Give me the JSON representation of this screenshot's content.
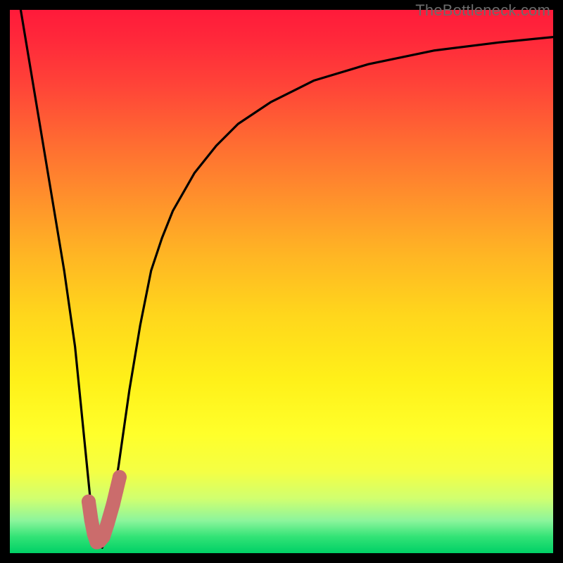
{
  "watermark": "TheBottleneck.com",
  "colors": {
    "marker": "#cb6c6c",
    "curve": "#000000",
    "frame": "#000000"
  },
  "chart_data": {
    "type": "line",
    "title": "",
    "xlabel": "",
    "ylabel": "",
    "xlim": [
      0,
      100
    ],
    "ylim": [
      0,
      100
    ],
    "grid": false,
    "series": [
      {
        "name": "bottleneck-curve",
        "x": [
          2,
          4,
          6,
          8,
          10,
          12,
          13,
          14,
          15,
          16,
          17,
          18,
          20,
          22,
          24,
          26,
          28,
          30,
          34,
          38,
          42,
          48,
          56,
          66,
          78,
          90,
          100
        ],
        "y": [
          100,
          88,
          76,
          64,
          52,
          38,
          28,
          18,
          8,
          2,
          1,
          4,
          16,
          30,
          42,
          52,
          58,
          63,
          70,
          75,
          79,
          83,
          87,
          90,
          92.5,
          94,
          95
        ]
      }
    ],
    "markers": {
      "name": "highlight-dots",
      "x": [
        14.5,
        15.0,
        15.5,
        16.0,
        16.5,
        17.2,
        18.0,
        19.0,
        19.6,
        20.2
      ],
      "y": [
        9.5,
        6.0,
        3.5,
        2.0,
        2.2,
        3.0,
        5.5,
        9.0,
        11.5,
        14.0
      ]
    }
  }
}
